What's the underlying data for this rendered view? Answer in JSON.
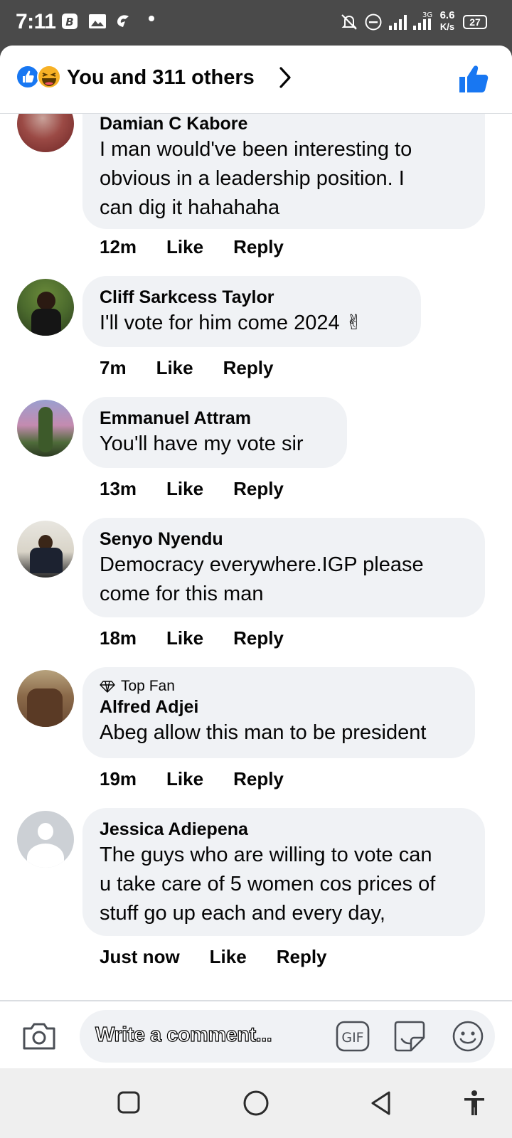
{
  "status_bar": {
    "time": "7:11",
    "network_speed_value": "6.6",
    "network_speed_unit": "K/s",
    "signal_label": "3G",
    "battery": "27"
  },
  "header": {
    "title": "You and 311 others"
  },
  "comments": [
    {
      "author": "Damian C Kabore",
      "lines": [
        "I man would've been interesting to",
        "obvious in a leadership position. I",
        "can dig it hahahaha"
      ],
      "time": "12m",
      "like": "Like",
      "reply": "Reply"
    },
    {
      "author": "Cliff Sarkcess Taylor",
      "lines": [
        "I'll vote for  him come 2024 ✌"
      ],
      "time": "7m",
      "like": "Like",
      "reply": "Reply"
    },
    {
      "author": "Emmanuel Attram",
      "lines": [
        "You'll have my vote sir"
      ],
      "time": "13m",
      "like": "Like",
      "reply": "Reply"
    },
    {
      "author": "Senyo Nyendu",
      "lines": [
        "Democracy everywhere.IGP please",
        "come for this man"
      ],
      "time": "18m",
      "like": "Like",
      "reply": "Reply"
    },
    {
      "badge": "Top Fan",
      "author": "Alfred Adjei",
      "lines": [
        "Abeg allow this man to be president"
      ],
      "time": "19m",
      "like": "Like",
      "reply": "Reply"
    },
    {
      "author": "Jessica Adiepena",
      "lines": [
        "The guys who are willing to vote can",
        "u take care of 5 women cos prices of",
        "stuff go up each and every day,"
      ],
      "time": "Just now",
      "like": "Like",
      "reply": "Reply"
    }
  ],
  "composer": {
    "placeholder": "Write a comment...",
    "gif_label": "GIF"
  },
  "colors": {
    "facebook_blue": "#1877f2",
    "bubble_bg": "#f0f2f5",
    "status_bar_bg": "#4a4a4a",
    "haha_yellow": "#f7b125"
  },
  "icons": [
    "like-reaction-icon",
    "haha-reaction-icon",
    "chevron-right-icon",
    "thumbs-up-icon",
    "diamond-icon",
    "camera-icon",
    "gif-icon",
    "sticker-icon",
    "emoji-icon",
    "recents-icon",
    "home-icon",
    "back-icon",
    "accessibility-icon"
  ]
}
